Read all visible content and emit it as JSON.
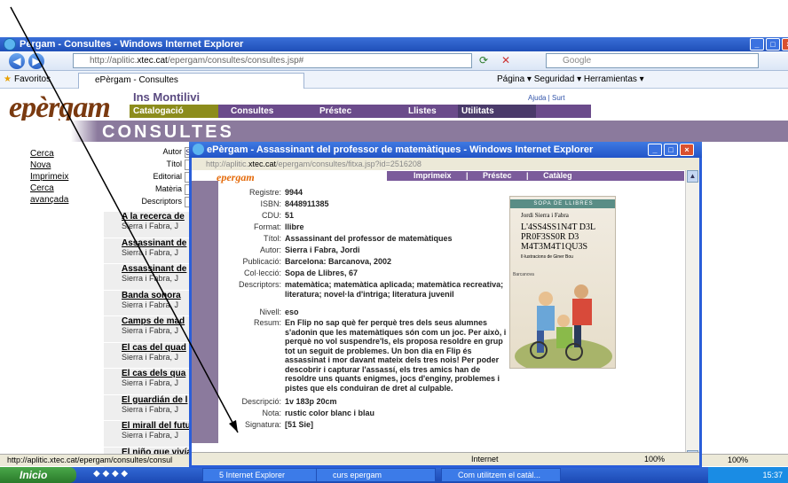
{
  "browser": {
    "title": "Pèrgam - Consultes - Windows Internet Explorer",
    "url_prefix": "http://aplitic.",
    "url_domain": "xtec.cat",
    "url_path": "/epergam/consultes/consultes.jsp#",
    "search_placeholder": "Google",
    "favorites_label": "Favoritos",
    "tab_label": "ePèrgam - Consultes",
    "tools": "Página ▾   Seguridad ▾   Herramientas ▾",
    "status_url": "http://aplitic.xtec.cat/epergam/consultes/consul",
    "zoom": "100%"
  },
  "site": {
    "school": "Ins Montilivi",
    "logo_main": "pèrgam",
    "logo_e": "e",
    "menu": [
      "Catalogació",
      "Consultes",
      "Préstec",
      "Llistes",
      "Utilitats"
    ],
    "help": "Ajuda | Surt",
    "section": "CONSULTES",
    "side_links": [
      "Cerca",
      "Nova",
      "Imprimeix",
      "Cerca avançada"
    ],
    "form_labels": [
      "Autor",
      "Títol",
      "Editorial",
      "Matèria",
      "Descriptors"
    ],
    "author_field_value": "Si",
    "results": [
      {
        "title": "A la recerca de",
        "author": "Sierra i Fabra, J"
      },
      {
        "title": "Assassinant de",
        "author": "Sierra i Fabra, J"
      },
      {
        "title": "Assassinant de",
        "author": "Sierra i Fabra, J"
      },
      {
        "title": "Banda sonora",
        "author": "Sierra i Fabra, J"
      },
      {
        "title": "Camps de mad",
        "author": "Sierra i Fabra, J"
      },
      {
        "title": "El cas del quad",
        "author": "Sierra i Fabra, J"
      },
      {
        "title": "El cas dels qua",
        "author": "Sierra i Fabra, J"
      },
      {
        "title": "El guardián de l",
        "author": "Sierra i Fabra, J"
      },
      {
        "title": "El mirall del futu",
        "author": "Sierra i Fabra, J"
      },
      {
        "title": "El niño que vivía",
        "author": "Sierra i Fabra, J"
      }
    ]
  },
  "popup": {
    "title": "ePèrgam - Assassinant del professor de matemàtiques - Windows Internet Explorer",
    "url_prefix": "http://aplitic.",
    "url_domain": "xtec.cat",
    "url_path": "/epergam/consultes/fitxa.jsp?id=2516208",
    "logo": "epergam",
    "menu": "Imprimeix | Préstec | Catàleg",
    "fields": [
      {
        "label": "Registre:",
        "value": "9944"
      },
      {
        "label": "ISBN:",
        "value": "8448911385"
      },
      {
        "label": "CDU:",
        "value": "51"
      },
      {
        "label": "Format:",
        "value": "llibre"
      },
      {
        "label": "Títol:",
        "value": "Assassinant del professor de matemàtiques"
      },
      {
        "label": "Autor:",
        "value": "Sierra i Fabra, Jordi"
      },
      {
        "label": "Publicació:",
        "value": "Barcelona: Barcanova, 2002"
      },
      {
        "label": "Col·lecció:",
        "value": "Sopa de Llibres, 67"
      },
      {
        "label": "Descriptors:",
        "value": "matemàtica; matemàtica aplicada; matemàtica recreativa; literatura; novel·la d'intriga; literatura juvenil"
      },
      {
        "label": "Nivell:",
        "value": "eso"
      },
      {
        "label": "Resum:",
        "value": "En Flip no sap què fer perquè tres dels seus alumnes s'adonin que les matemàtiques són com un joc. Per això, i perquè no vol suspendre'ls, els proposa resoldre en grup tot un seguit de problemes. Un bon dia en Flip és assassinat i mor davant mateix dels tres nois! Per poder descobrir i capturar l'assassí, els tres amics han de resoldre uns quants enigmes, jocs d'enginy, problemes i pistes que els conduiran de dret al culpable."
      },
      {
        "label": "Descripció:",
        "value": "1v 183p 20cm"
      },
      {
        "label": "Nota:",
        "value": "rustic color blanc i blau"
      },
      {
        "label": "Signatura:",
        "value": "[51 Sie]"
      }
    ],
    "cover": {
      "series": "SOPA DE LLIBRES",
      "author": "Jordi Sierra i Fabra",
      "title": "L'4SS4SS1N4T D3L PR0F3SS0R D3 M4T3M4T1QU3S",
      "illustrations": "Il·lustracions de Giner Bou",
      "publisher": "Barcanova"
    },
    "zone": "Internet",
    "zoom": "100%"
  },
  "taskbar": {
    "start": "Inicio",
    "tasks": [
      "5 Internet Explorer",
      "curs epergam",
      "Com utilitzem el catàl..."
    ],
    "clock": "15:37"
  }
}
